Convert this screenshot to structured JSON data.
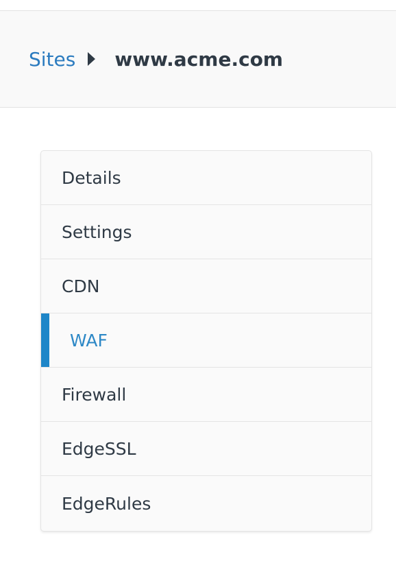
{
  "breadcrumb": {
    "parent_label": "Sites",
    "current_label": "www.acme.com"
  },
  "menu": {
    "active_index": 3,
    "accent_color": "#1e86c8",
    "items": [
      {
        "label": "Details"
      },
      {
        "label": "Settings"
      },
      {
        "label": "CDN"
      },
      {
        "label": "WAF"
      },
      {
        "label": "Firewall"
      },
      {
        "label": "EdgeSSL"
      },
      {
        "label": "EdgeRules"
      }
    ]
  }
}
